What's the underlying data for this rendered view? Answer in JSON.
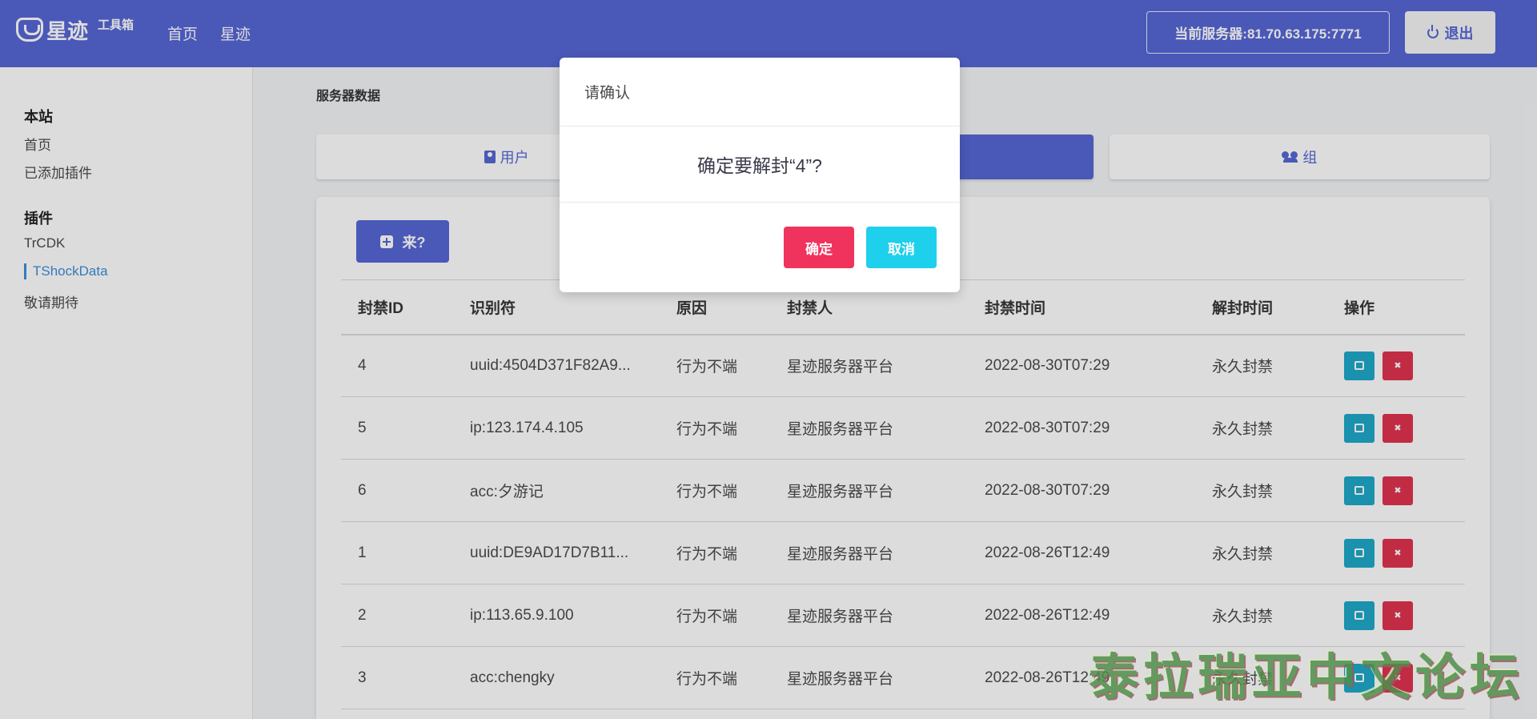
{
  "app": {
    "logo_text": "星迹",
    "logo_sub": "工具箱",
    "nav": [
      "首页",
      "星迹"
    ],
    "server_label": "当前服务器:81.70.63.175:7771",
    "logout_label": "退出",
    "accent_color": "#5566d6"
  },
  "sidebar": {
    "section1_title": "本站",
    "section1_items": [
      "首页",
      "已添加插件"
    ],
    "section2_title": "插件",
    "section2_items": [
      "TrCDK",
      "TShockData",
      "敬请期待"
    ],
    "active_item": "TShockData"
  },
  "main": {
    "breadcrumb": "服务器数据",
    "tabs": [
      "用户",
      "",
      "组"
    ],
    "add_button": "来?",
    "table": {
      "headers": [
        "封禁ID",
        "识别符",
        "原因",
        "封禁人",
        "封禁时间",
        "解封时间",
        "操作"
      ],
      "rows": [
        [
          "4",
          "uuid:4504D371F82A9...",
          "行为不端",
          "星迹服务器平台",
          "2022-08-30T07:29",
          "永久封禁"
        ],
        [
          "5",
          "ip:123.174.4.105",
          "行为不端",
          "星迹服务器平台",
          "2022-08-30T07:29",
          "永久封禁"
        ],
        [
          "6",
          "acc:夕游记",
          "行为不端",
          "星迹服务器平台",
          "2022-08-30T07:29",
          "永久封禁"
        ],
        [
          "1",
          "uuid:DE9AD17D7B11...",
          "行为不端",
          "星迹服务器平台",
          "2022-08-26T12:49",
          "永久封禁"
        ],
        [
          "2",
          "ip:113.65.9.100",
          "行为不端",
          "星迹服务器平台",
          "2022-08-26T12:49",
          "永久封禁"
        ],
        [
          "3",
          "acc:chengky",
          "行为不端",
          "星迹服务器平台",
          "2022-08-26T12:49",
          "永久封禁"
        ]
      ]
    }
  },
  "modal": {
    "title": "请确认",
    "message": "确定要解封“4”?",
    "confirm_label": "确定",
    "cancel_label": "取消",
    "confirm_color": "#f0335c",
    "cancel_color": "#1fd0ec"
  },
  "watermark": "泰拉瑞亚中文论坛"
}
